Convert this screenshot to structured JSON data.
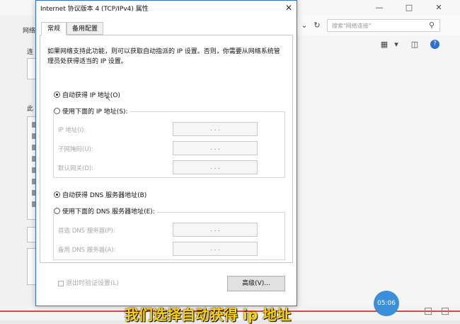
{
  "background": {
    "search_placeholder": "搜索\"网络连接\"",
    "left_labels": [
      "网络",
      "连",
      "此"
    ],
    "icons": {
      "search": "search-icon",
      "minimize": "minimize-icon",
      "maximize": "maximize-icon",
      "close": "close-icon",
      "help": "help-icon",
      "refresh": "refresh-icon",
      "dropdown": "chevron-down-icon"
    }
  },
  "dialog": {
    "title": "Internet 协议版本 4 (TCP/IPv4) 属性",
    "tabs": [
      {
        "label": "常规"
      },
      {
        "label": "备用配置"
      }
    ],
    "description": "如果网络支持此功能，则可以获取自动指派的 IP 设置。否则，你需要从网络系统管理员处获得适当的 IP 设置。",
    "ip_section": {
      "auto_label": "自动获得 IP 地址(O)",
      "manual_label": "使用下面的 IP 地址(S):",
      "auto_selected": true,
      "fields": [
        {
          "label": "IP 地址(I):",
          "value": ".  .  ."
        },
        {
          "label": "子网掩码(U):",
          "value": ".  .  ."
        },
        {
          "label": "默认网关(D):",
          "value": ".  .  ."
        }
      ]
    },
    "dns_section": {
      "auto_label": "自动获得 DNS 服务器地址(B)",
      "manual_label": "使用下面的 DNS 服务器地址(E):",
      "auto_selected": true,
      "fields": [
        {
          "label": "首选 DNS 服务器(P):",
          "value": ".  .  ."
        },
        {
          "label": "备用 DNS 服务器(A):",
          "value": ".  .  ."
        }
      ]
    },
    "validate_on_exit": "退出时验证设置(L)",
    "advanced_button": "高级(V)..."
  },
  "video": {
    "subtitle": "我们选择自动获得 ip 地址",
    "time": "05:06",
    "colors": {
      "progress": "#d24a4a",
      "subtitle": "#ffd400",
      "badge": "#3b8fd9",
      "dialog_border": "#2f6fd6"
    }
  }
}
